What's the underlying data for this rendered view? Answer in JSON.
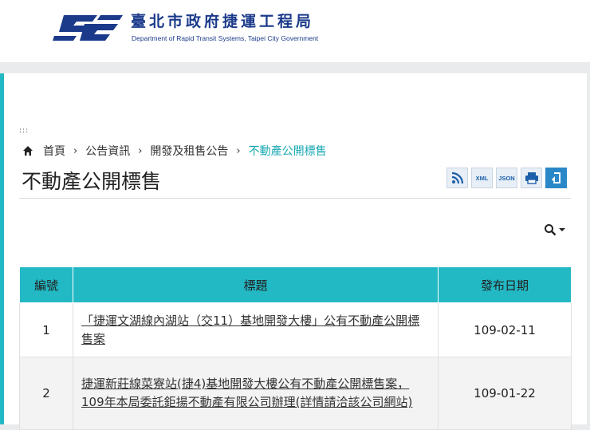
{
  "header": {
    "org_name_zh": "臺北市政府捷運工程局",
    "org_name_en": "Department of Rapid Transit Systems, Taipei City Government",
    "logo_colors": {
      "primary": "#1b3a8a"
    }
  },
  "breadcrumb": {
    "items": [
      "首頁",
      "公告資訊",
      "開發及租售公告"
    ],
    "current": "不動產公開標售",
    "separator": "›"
  },
  "page": {
    "title": "不動產公開標售"
  },
  "toolbar": {
    "buttons": [
      {
        "name": "rss",
        "icon": "rss-icon"
      },
      {
        "name": "xml",
        "label": "XML"
      },
      {
        "name": "json",
        "label": "JSON"
      },
      {
        "name": "print",
        "icon": "print-icon"
      },
      {
        "name": "back",
        "icon": "back-icon"
      }
    ]
  },
  "table": {
    "headers": [
      "編號",
      "標題",
      "發布日期"
    ],
    "rows": [
      {
        "no": "1",
        "title": "「捷運文湖線內湖站（交11）基地開發大樓」公有不動產公開標售案",
        "date": "109-02-11"
      },
      {
        "no": "2",
        "title": "捷運新莊線菜寮站(捷4)基地開發大樓公有不動產公開標售案，109年本局委託鉅揚不動產有限公司辦理(詳情請洽該公司網站)",
        "date": "109-01-22"
      }
    ]
  },
  "colors": {
    "accent": "#22b8c4",
    "breadcrumb_current": "#1aa9b3",
    "brand": "#1b3a8a"
  }
}
